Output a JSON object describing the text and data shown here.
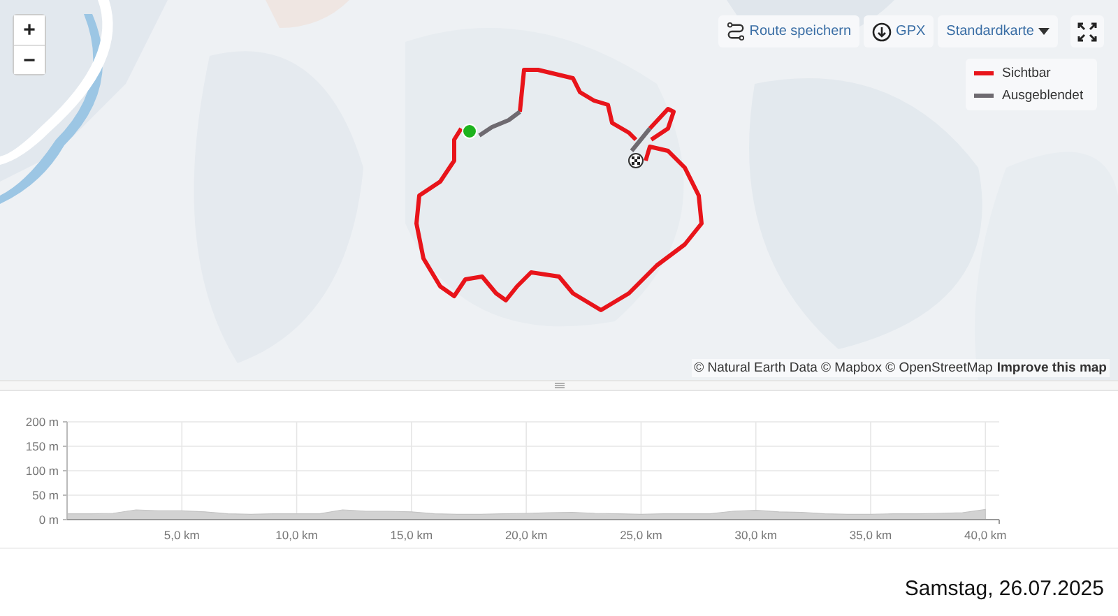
{
  "map": {
    "zoom_controls": [
      "+",
      "−"
    ],
    "toolbar": {
      "save_route": "Route speichern",
      "gpx": "GPX",
      "map_style": "Standardkarte"
    },
    "legend": [
      {
        "label": "Sichtbar",
        "color": "#e8141a"
      },
      {
        "label": "Ausgeblendet",
        "color": "#6e6a70"
      }
    ],
    "attribution": "© Natural Earth Data © Mapbox © OpenStreetMap",
    "attribution_link": "Improve this map"
  },
  "elevation_chart": {
    "chart_data": {
      "type": "area",
      "grid": true,
      "xlim": [
        0,
        40.6
      ],
      "ylim": [
        0,
        200
      ],
      "x": [
        0,
        1,
        2,
        3,
        4,
        5,
        6,
        7,
        8,
        9,
        10,
        11,
        12,
        13,
        14,
        15,
        16,
        17,
        18,
        19,
        20,
        21,
        22,
        23,
        24,
        25,
        26,
        27,
        28,
        29,
        30,
        31,
        32,
        33,
        34,
        35,
        36,
        37,
        38,
        39,
        40
      ],
      "values": [
        12,
        12,
        13,
        20,
        18,
        18,
        16,
        12,
        11,
        12,
        12,
        12,
        20,
        17,
        17,
        16,
        12,
        11,
        11,
        12,
        13,
        14,
        15,
        13,
        12,
        11,
        12,
        12,
        12,
        17,
        19,
        16,
        15,
        12,
        11,
        11,
        12,
        12,
        13,
        14,
        21
      ],
      "yticks": [
        {
          "value": 0,
          "label": "0 m"
        },
        {
          "value": 50,
          "label": "50 m"
        },
        {
          "value": 100,
          "label": "100 m"
        },
        {
          "value": 150,
          "label": "150 m"
        },
        {
          "value": 200,
          "label": "200 m"
        }
      ],
      "xticks": [
        {
          "value": 5,
          "label": "5,0 km"
        },
        {
          "value": 10,
          "label": "10,0 km"
        },
        {
          "value": 15,
          "label": "15,0 km"
        },
        {
          "value": 20,
          "label": "20,0 km"
        },
        {
          "value": 25,
          "label": "25,0 km"
        },
        {
          "value": 30,
          "label": "30,0 km"
        },
        {
          "value": 35,
          "label": "35,0 km"
        },
        {
          "value": 40,
          "label": "40,0 km"
        }
      ]
    }
  },
  "date": "Samstag, 26.07.2025"
}
